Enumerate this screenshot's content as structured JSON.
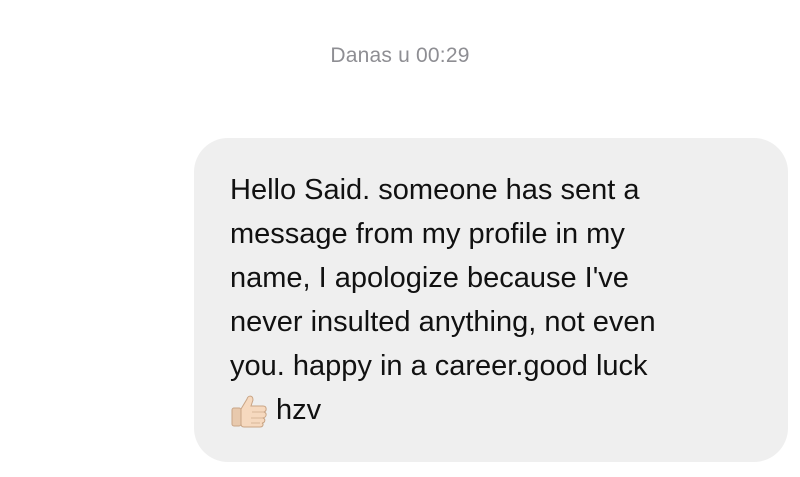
{
  "conversation": {
    "timestamp": "Danas u 00:29"
  },
  "message": {
    "body": "Hello Said. someone has sent a\nmessage from my profile in my\nname, I apologize because I've\nnever insulted anything, not even\nyou. happy in a career.good luck",
    "emoji": "thumbs-up-icon",
    "signature": "hzv"
  },
  "colors": {
    "bubble": "#efefef",
    "timestamp": "#8e8e93",
    "text": "#111111",
    "emoji_skin": "#f6d9bf"
  }
}
